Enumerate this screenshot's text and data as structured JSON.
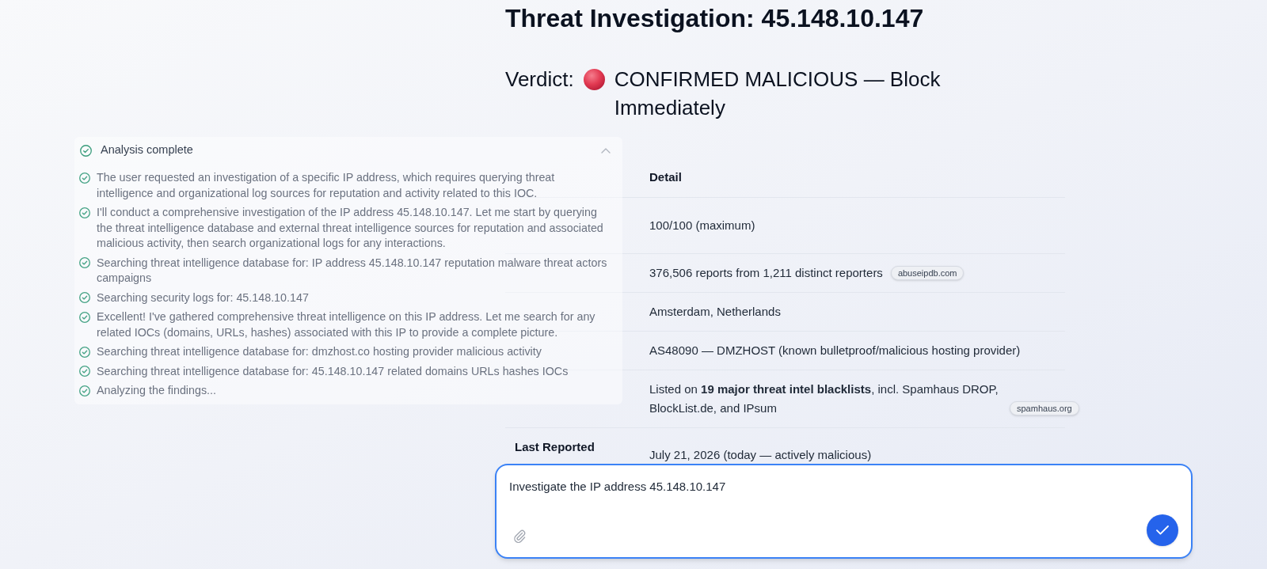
{
  "page_title": "Threat Investigation: 45.148.10.147",
  "verdict": {
    "label": "Verdict:",
    "text": "CONFIRMED MALICIOUS — Block Immediately"
  },
  "analysis_panel": {
    "title": "Analysis complete",
    "expanded": true,
    "steps": [
      "The user requested an investigation of a specific IP address, which requires querying threat intelligence and organizational log sources for reputation and activity related to this IOC.",
      "I'll conduct a comprehensive investigation of the IP address 45.148.10.147. Let me start by querying the threat intelligence database and external threat intelligence sources for reputation and associated malicious activity, then search organizational logs for any interactions.",
      "Searching threat intelligence database for: IP address 45.148.10.147 reputation malware threat actors campaigns",
      "Searching security logs for: 45.148.10.147",
      "Excellent! I've gathered comprehensive threat intelligence on this IP address. Let me search for any related IOCs (domains, URLs, hashes) associated with this IP to provide a complete picture.",
      "Searching threat intelligence database for: dmzhost.co hosting provider malicious activity",
      "Searching threat intelligence database for: 45.148.10.147 related domains URLs hashes IOCs",
      "Analyzing the findings..."
    ]
  },
  "table": {
    "detail_heading": "Detail",
    "rows": [
      {
        "detail": "100/100 (maximum)"
      },
      {
        "detail": "376,506 reports from 1,211 distinct reporters",
        "source": "abuseipdb.com"
      },
      {
        "detail": "Amsterdam, Netherlands"
      },
      {
        "detail": "AS48090 — DMZHOST (known bulletproof/malicious hosting provider)"
      },
      {
        "detail": "Listed on **19 major threat intel blacklists**, incl. Spamhaus DROP, BlockList.de, and IPsum",
        "source": "spamhaus.org"
      },
      {
        "label": "Last Reported",
        "detail": "July 21, 2026 (today — actively malicious)"
      }
    ]
  },
  "composer": {
    "value": "Investigate the IP address 45.148.10.147"
  }
}
